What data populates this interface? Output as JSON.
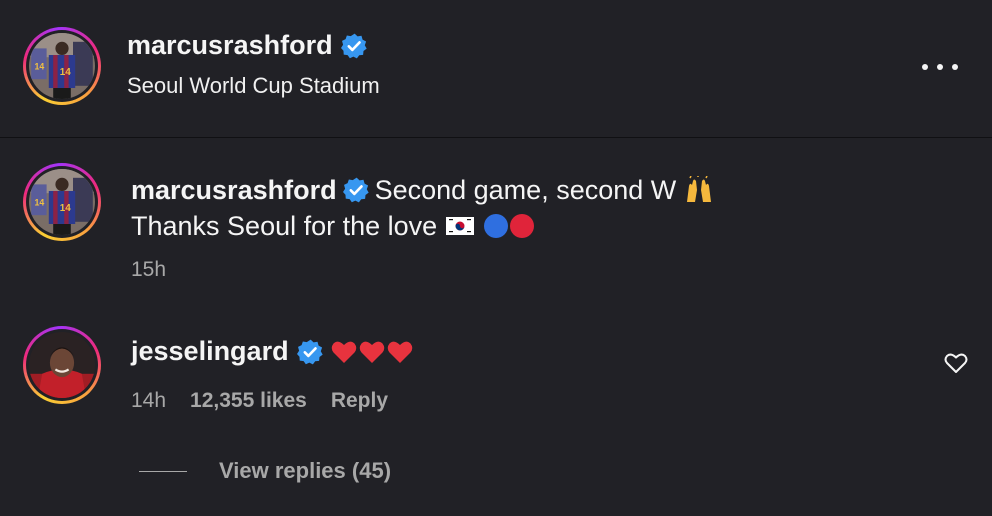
{
  "post_header": {
    "username": "marcusrashford",
    "location": "Seoul World Cup Stadium",
    "more_icon": "more-options-icon"
  },
  "caption": {
    "username": "marcusrashford",
    "text_line1": "Second game, second W",
    "text_line2": "Thanks Seoul for the love",
    "emoji_line1": "raising-hands",
    "emoji_line2": [
      "south-korea-flag",
      "blue-circle",
      "red-circle"
    ],
    "time": "15h"
  },
  "comment": {
    "username": "jesselingard",
    "hearts": "❤️❤️❤️",
    "time": "14h",
    "likes": "12,355 likes",
    "reply": "Reply",
    "view_replies": "View replies (45)",
    "like_icon": "heart-outline-icon"
  },
  "colors": {
    "background": "#212126",
    "text": "#f5f5f5",
    "muted": "#a8a8a8",
    "verified": "#3797f0"
  }
}
